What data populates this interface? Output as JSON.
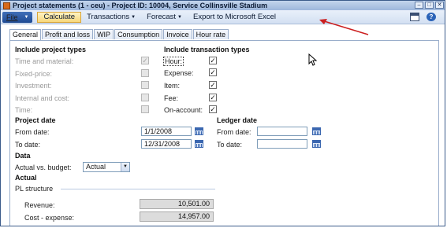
{
  "window": {
    "title": "Project statements (1 - ceu) - Project ID: 10004, Service Collinsville Stadium"
  },
  "menu": {
    "file": "File",
    "calculate": "Calculate",
    "transactions": "Transactions",
    "forecast": "Forecast",
    "export": "Export to Microsoft Excel"
  },
  "tabs": [
    "General",
    "Profit and loss",
    "WIP",
    "Consumption",
    "Invoice",
    "Hour rate"
  ],
  "include_project_types": {
    "header": "Include project types",
    "items": [
      {
        "label": "Time and material:",
        "checked": true
      },
      {
        "label": "Fixed-price:",
        "checked": false
      },
      {
        "label": "Investment:",
        "checked": false
      },
      {
        "label": "Internal and cost:",
        "checked": false
      },
      {
        "label": "Time:",
        "checked": false
      }
    ]
  },
  "include_transaction_types": {
    "header": "Include transaction types",
    "items": [
      {
        "label": "Hour:",
        "checked": true
      },
      {
        "label": "Expense:",
        "checked": true
      },
      {
        "label": "Item:",
        "checked": true
      },
      {
        "label": "Fee:",
        "checked": true
      },
      {
        "label": "On-account:",
        "checked": true
      }
    ]
  },
  "project_date": {
    "header": "Project date",
    "from_label": "From date:",
    "from_value": "1/1/2008",
    "to_label": "To date:",
    "to_value": "12/31/2008"
  },
  "ledger_date": {
    "header": "Ledger date",
    "from_label": "From date:",
    "from_value": "",
    "to_label": "To date:",
    "to_value": ""
  },
  "data_section": {
    "header": "Data",
    "actual_vs_budget_label": "Actual vs. budget:",
    "actual_vs_budget_value": "Actual"
  },
  "actual_section": {
    "header": "Actual",
    "pl_structure": "PL structure",
    "revenue_label": "Revenue:",
    "revenue_value": "10,501.00",
    "cost_label": "Cost - expense:",
    "cost_value": "14,957.00"
  },
  "colors": {
    "accent": "#1e4a93",
    "calculate_bg": "#f7d77a",
    "annotation_arrow": "#cc2020"
  },
  "icons": [
    "app-icon",
    "file-dropdown-icon",
    "window-icon",
    "help-icon",
    "calendar-icon",
    "mouse-cursor-icon"
  ]
}
